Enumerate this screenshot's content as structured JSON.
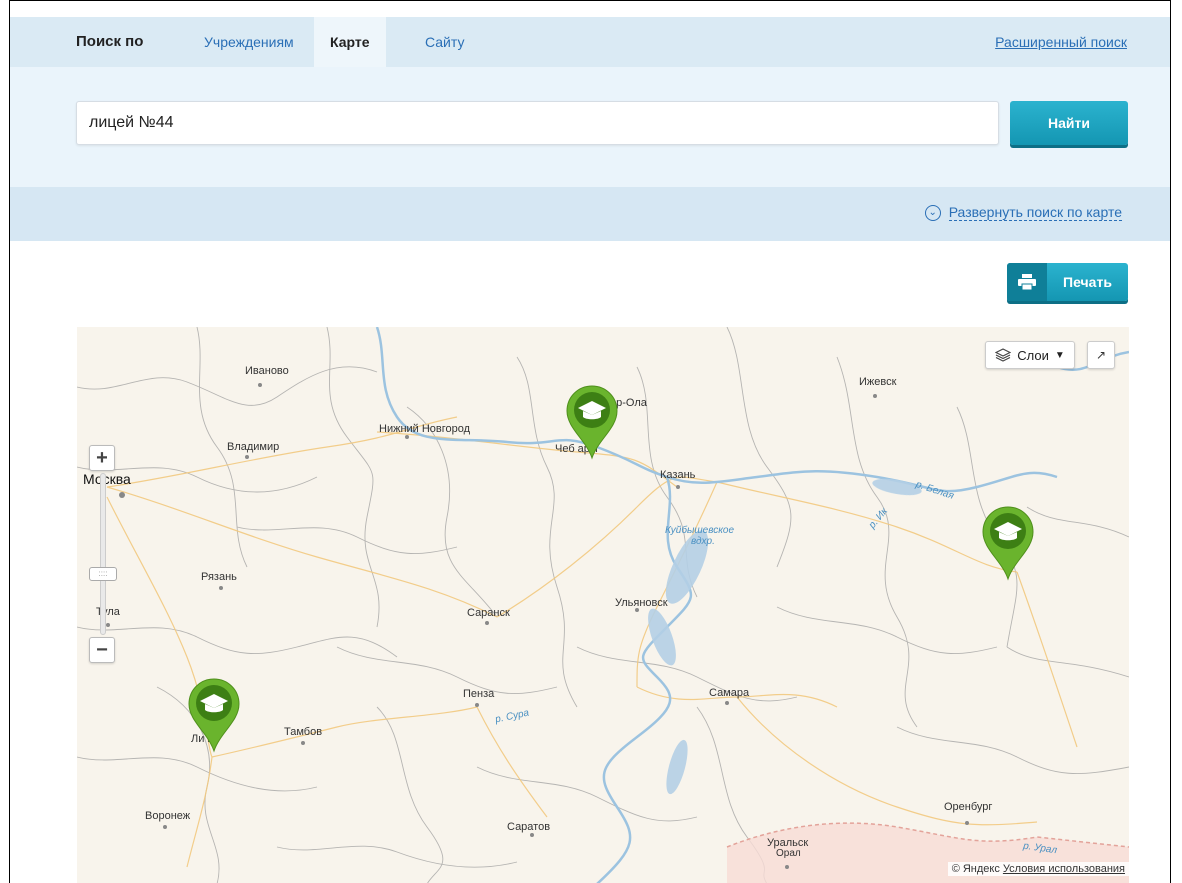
{
  "tabs": {
    "lead": "Поиск по",
    "items": [
      {
        "label": "Учреждениям",
        "active": false
      },
      {
        "label": "Карте",
        "active": true
      },
      {
        "label": "Сайту",
        "active": false
      }
    ],
    "advanced_search": "Расширенный поиск"
  },
  "search": {
    "value": "лицей №44",
    "button": "Найти"
  },
  "expand": {
    "label": "Развернуть поиск по карте"
  },
  "print": {
    "label": "Печать"
  },
  "map": {
    "layers_label": "Слои",
    "copyright": "© Яндекс",
    "terms": "Условия использования",
    "cities": {
      "ivanovo": "Иваново",
      "izhevsk": "Ижевск",
      "nizhny": "Нижний Новгород",
      "yoshkar": "ар-Ола",
      "vladimir": "Владимир",
      "cheboksary": "Чеб   ары",
      "moscow": "Москва",
      "kazan": "Казань",
      "ryazan": "Рязань",
      "tula": "Тула",
      "saransk": "Саранск",
      "ulyanovsk": "Ульяновск",
      "penza": "Пенза",
      "samara": "Самара",
      "lipetsk": "Ли   цк",
      "tambov": "Тамбов",
      "voronezh": "Воронеж",
      "saratov": "Саратов",
      "orenburg": "Оренбург",
      "uralsk": "Уральск",
      "oral": "Орал"
    },
    "rivers": {
      "belaya": "р. Белая",
      "ik": "р. Ик",
      "kuibyshev1": "Куйбышевское",
      "kuibyshev2": "вдхр.",
      "sura": "р. Сура",
      "ural": "р. Урал"
    },
    "colors": {
      "pin": "#6ab42d",
      "pin_dark": "#3d7f14",
      "water": "#b4d0e6",
      "road": "#f2c980"
    }
  }
}
